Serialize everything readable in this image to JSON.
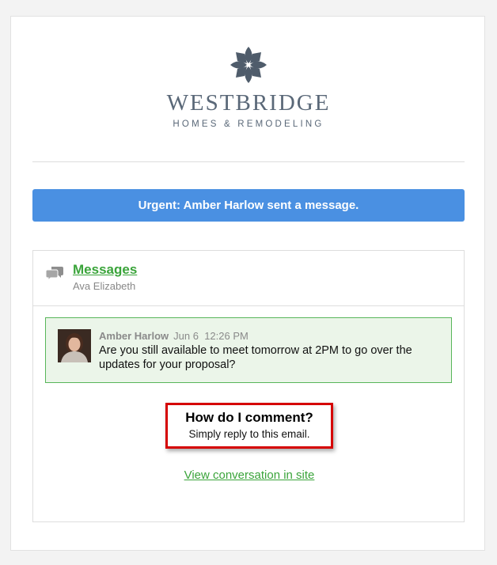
{
  "brand": {
    "name": "WESTBRIDGE",
    "tagline": "HOMES & REMODELING",
    "logo_icon": "flower-logo-icon",
    "color": "#5a6878"
  },
  "banner": {
    "text": "Urgent: Amber Harlow sent a message.",
    "color": "#4a90e2"
  },
  "panel": {
    "icon": "chat-bubbles-icon",
    "title": "Messages",
    "subtitle": "Ava Elizabeth"
  },
  "message": {
    "author": "Amber Harlow",
    "date": "Jun 6",
    "time": "12:26 PM",
    "text": "Are you still available to meet tomorrow at 2PM to go over the updates for your proposal?"
  },
  "help": {
    "title": "How do I comment?",
    "subtitle": "Simply reply to this email."
  },
  "footer": {
    "link_text": "View conversation in site",
    "link_color": "#3aa43a"
  }
}
